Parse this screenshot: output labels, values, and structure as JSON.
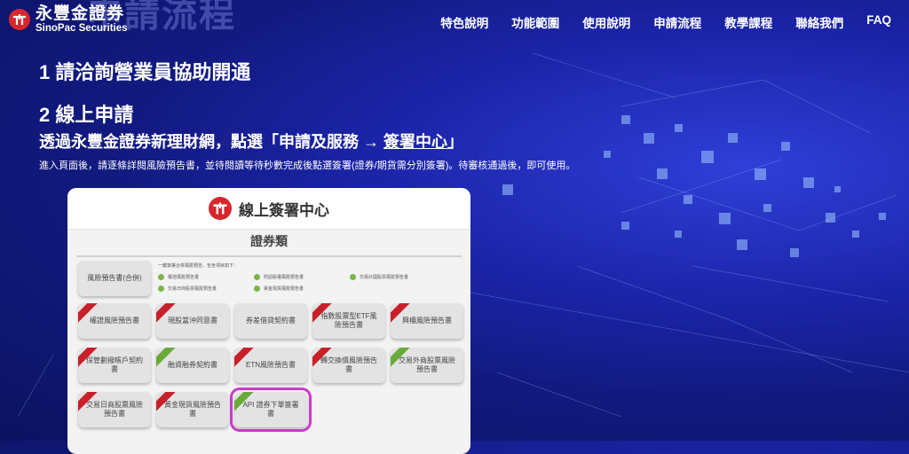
{
  "brand": {
    "name_cn": "永豐金證券",
    "name_en": "SinoPac Securities",
    "ghost_title": "申請流程"
  },
  "nav": [
    "特色說明",
    "功能範圍",
    "使用說明",
    "申請流程",
    "教學課程",
    "聯絡我們",
    "FAQ"
  ],
  "content": {
    "step1": "1 請洽詢營業員協助開通",
    "step2": "2 線上申請",
    "instruction_prefix": "透過永豐金證券新理財網，點選「申請及服務 → ",
    "instruction_link": "簽署中心",
    "instruction_suffix": "」",
    "note": "進入頁面後，請逐條詳閱風險預告書，並待閱讀等待秒數完成後點選簽署(證券/期貨需分別簽署)。待審核通過後，即可使用。"
  },
  "card": {
    "title": "線上簽署中心",
    "section": "證券類",
    "combined_tile": "風險預告書(合併)",
    "checklist_intro": "一鍵簽署合併風險預告，包含項目如下：",
    "checklist": [
      "權證風險預告書",
      "附認股權風險預告書",
      "交易外國股票風險預告書",
      "交易日商股票風險預告書",
      "黃金現貨風險預告書"
    ],
    "tiles": [
      {
        "label": "權證風險預告書",
        "badge": "red"
      },
      {
        "label": "現股當沖同意書",
        "badge": "red"
      },
      {
        "label": "券差借貸契約書",
        "badge": ""
      },
      {
        "label": "指數股票型ETF風險預告書",
        "badge": "red"
      },
      {
        "label": "興櫃風險預告書",
        "badge": "red"
      },
      {
        "label": "保管劃撥帳戶契約書",
        "badge": "red"
      },
      {
        "label": "融資融券契約書",
        "badge": "green"
      },
      {
        "label": "ETN風險預告書",
        "badge": "red"
      },
      {
        "label": "轉交換債風險預告書",
        "badge": "red"
      },
      {
        "label": "交易外商股票風險預告書",
        "badge": "green"
      },
      {
        "label": "交易日商股票風險預告書",
        "badge": "red"
      },
      {
        "label": "黃金現貨風險預告書",
        "badge": "red"
      },
      {
        "label": "API 證券下單簽署書",
        "badge": "green"
      }
    ],
    "highlight_color": "#c83cc8"
  },
  "colors": {
    "brand_red": "#d8262d",
    "bg_blue": "#1b24a8"
  }
}
